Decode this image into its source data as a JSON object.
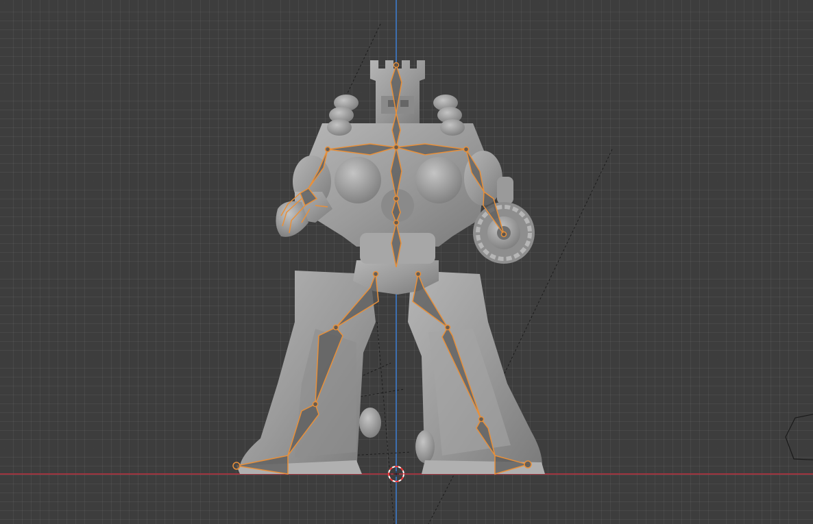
{
  "viewport": {
    "mode": "3d-viewport",
    "shading": "solid",
    "overlay": "armature",
    "colors": {
      "background": "#3d3d3d",
      "grid_line": "#474747",
      "axis_x": "#a0343f",
      "axis_z": "#3d6fb0",
      "mesh": "#9a9a9a",
      "bone_selected": "#e8903a",
      "cursor_ring": "#ff3b3b"
    }
  },
  "model": {
    "name_icon": "robot-mesh",
    "armature_icon": "armature-bones"
  },
  "cursor": {
    "icon": "3d-cursor-icon"
  }
}
